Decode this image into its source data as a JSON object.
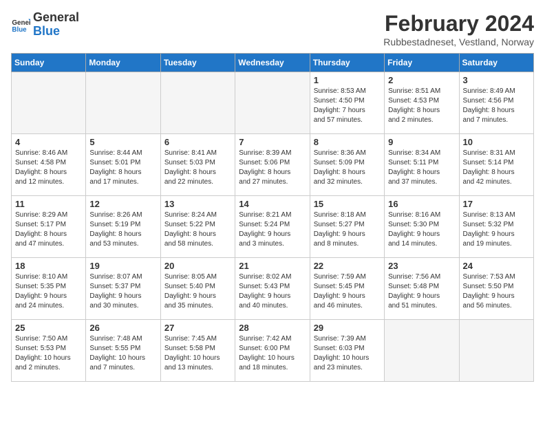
{
  "logo": {
    "line1": "General",
    "line2": "Blue"
  },
  "title": "February 2024",
  "location": "Rubbestadneset, Vestland, Norway",
  "days_of_week": [
    "Sunday",
    "Monday",
    "Tuesday",
    "Wednesday",
    "Thursday",
    "Friday",
    "Saturday"
  ],
  "weeks": [
    [
      {
        "day": "",
        "info": ""
      },
      {
        "day": "",
        "info": ""
      },
      {
        "day": "",
        "info": ""
      },
      {
        "day": "",
        "info": ""
      },
      {
        "day": "1",
        "info": "Sunrise: 8:53 AM\nSunset: 4:50 PM\nDaylight: 7 hours\nand 57 minutes."
      },
      {
        "day": "2",
        "info": "Sunrise: 8:51 AM\nSunset: 4:53 PM\nDaylight: 8 hours\nand 2 minutes."
      },
      {
        "day": "3",
        "info": "Sunrise: 8:49 AM\nSunset: 4:56 PM\nDaylight: 8 hours\nand 7 minutes."
      }
    ],
    [
      {
        "day": "4",
        "info": "Sunrise: 8:46 AM\nSunset: 4:58 PM\nDaylight: 8 hours\nand 12 minutes."
      },
      {
        "day": "5",
        "info": "Sunrise: 8:44 AM\nSunset: 5:01 PM\nDaylight: 8 hours\nand 17 minutes."
      },
      {
        "day": "6",
        "info": "Sunrise: 8:41 AM\nSunset: 5:03 PM\nDaylight: 8 hours\nand 22 minutes."
      },
      {
        "day": "7",
        "info": "Sunrise: 8:39 AM\nSunset: 5:06 PM\nDaylight: 8 hours\nand 27 minutes."
      },
      {
        "day": "8",
        "info": "Sunrise: 8:36 AM\nSunset: 5:09 PM\nDaylight: 8 hours\nand 32 minutes."
      },
      {
        "day": "9",
        "info": "Sunrise: 8:34 AM\nSunset: 5:11 PM\nDaylight: 8 hours\nand 37 minutes."
      },
      {
        "day": "10",
        "info": "Sunrise: 8:31 AM\nSunset: 5:14 PM\nDaylight: 8 hours\nand 42 minutes."
      }
    ],
    [
      {
        "day": "11",
        "info": "Sunrise: 8:29 AM\nSunset: 5:17 PM\nDaylight: 8 hours\nand 47 minutes."
      },
      {
        "day": "12",
        "info": "Sunrise: 8:26 AM\nSunset: 5:19 PM\nDaylight: 8 hours\nand 53 minutes."
      },
      {
        "day": "13",
        "info": "Sunrise: 8:24 AM\nSunset: 5:22 PM\nDaylight: 8 hours\nand 58 minutes."
      },
      {
        "day": "14",
        "info": "Sunrise: 8:21 AM\nSunset: 5:24 PM\nDaylight: 9 hours\nand 3 minutes."
      },
      {
        "day": "15",
        "info": "Sunrise: 8:18 AM\nSunset: 5:27 PM\nDaylight: 9 hours\nand 8 minutes."
      },
      {
        "day": "16",
        "info": "Sunrise: 8:16 AM\nSunset: 5:30 PM\nDaylight: 9 hours\nand 14 minutes."
      },
      {
        "day": "17",
        "info": "Sunrise: 8:13 AM\nSunset: 5:32 PM\nDaylight: 9 hours\nand 19 minutes."
      }
    ],
    [
      {
        "day": "18",
        "info": "Sunrise: 8:10 AM\nSunset: 5:35 PM\nDaylight: 9 hours\nand 24 minutes."
      },
      {
        "day": "19",
        "info": "Sunrise: 8:07 AM\nSunset: 5:37 PM\nDaylight: 9 hours\nand 30 minutes."
      },
      {
        "day": "20",
        "info": "Sunrise: 8:05 AM\nSunset: 5:40 PM\nDaylight: 9 hours\nand 35 minutes."
      },
      {
        "day": "21",
        "info": "Sunrise: 8:02 AM\nSunset: 5:43 PM\nDaylight: 9 hours\nand 40 minutes."
      },
      {
        "day": "22",
        "info": "Sunrise: 7:59 AM\nSunset: 5:45 PM\nDaylight: 9 hours\nand 46 minutes."
      },
      {
        "day": "23",
        "info": "Sunrise: 7:56 AM\nSunset: 5:48 PM\nDaylight: 9 hours\nand 51 minutes."
      },
      {
        "day": "24",
        "info": "Sunrise: 7:53 AM\nSunset: 5:50 PM\nDaylight: 9 hours\nand 56 minutes."
      }
    ],
    [
      {
        "day": "25",
        "info": "Sunrise: 7:50 AM\nSunset: 5:53 PM\nDaylight: 10 hours\nand 2 minutes."
      },
      {
        "day": "26",
        "info": "Sunrise: 7:48 AM\nSunset: 5:55 PM\nDaylight: 10 hours\nand 7 minutes."
      },
      {
        "day": "27",
        "info": "Sunrise: 7:45 AM\nSunset: 5:58 PM\nDaylight: 10 hours\nand 13 minutes."
      },
      {
        "day": "28",
        "info": "Sunrise: 7:42 AM\nSunset: 6:00 PM\nDaylight: 10 hours\nand 18 minutes."
      },
      {
        "day": "29",
        "info": "Sunrise: 7:39 AM\nSunset: 6:03 PM\nDaylight: 10 hours\nand 23 minutes."
      },
      {
        "day": "",
        "info": ""
      },
      {
        "day": "",
        "info": ""
      }
    ]
  ]
}
